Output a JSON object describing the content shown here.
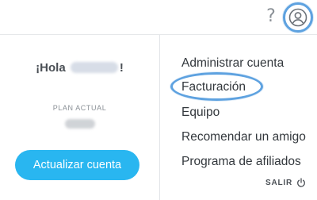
{
  "header": {
    "help_glyph": "?",
    "icons": {
      "help": "question-mark-icon",
      "account": "user-circle-icon"
    },
    "accent_color": "#5ea2e0"
  },
  "account_card": {
    "greeting_prefix": "¡Hola",
    "greeting_suffix": "!",
    "plan_label": "PLAN ACTUAL",
    "upgrade_button": "Actualizar cuenta",
    "button_color": "#29b6f0"
  },
  "menu": {
    "items": [
      {
        "label": "Administrar cuenta"
      },
      {
        "label": "Facturación"
      },
      {
        "label": "Equipo"
      },
      {
        "label": "Recomendar un amigo"
      },
      {
        "label": "Programa de afiliados"
      }
    ],
    "logout_label": "SALIR",
    "logout_icon": "power-icon"
  }
}
